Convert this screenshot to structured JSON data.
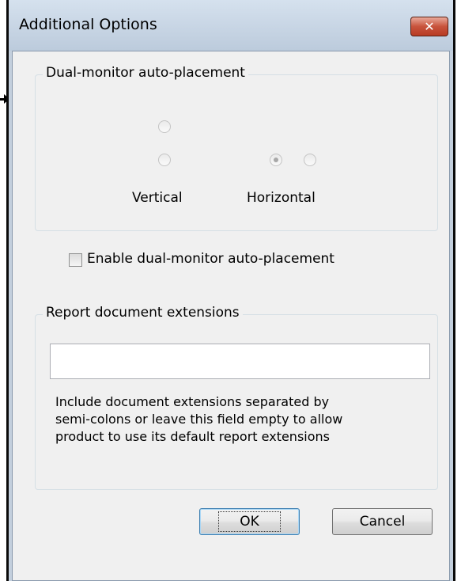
{
  "window": {
    "title": "Additional Options",
    "close_glyph": "✕"
  },
  "placement_group": {
    "title": "Dual-monitor auto-placement",
    "vertical_label": "Vertical",
    "horizontal_label": "Horizontal",
    "selected": "horizontal-left"
  },
  "enable_checkbox": {
    "label": "Enable dual-monitor auto-placement",
    "checked": false
  },
  "extensions_group": {
    "title": "Report document extensions",
    "input_value": "",
    "help_lines": [
      "Include document extensions separated by",
      "semi-colons or leave this field empty to allow",
      "product to use its default report extensions"
    ]
  },
  "buttons": {
    "ok_label": "OK",
    "cancel_label": "Cancel"
  },
  "icons": [
    "close-icon"
  ]
}
